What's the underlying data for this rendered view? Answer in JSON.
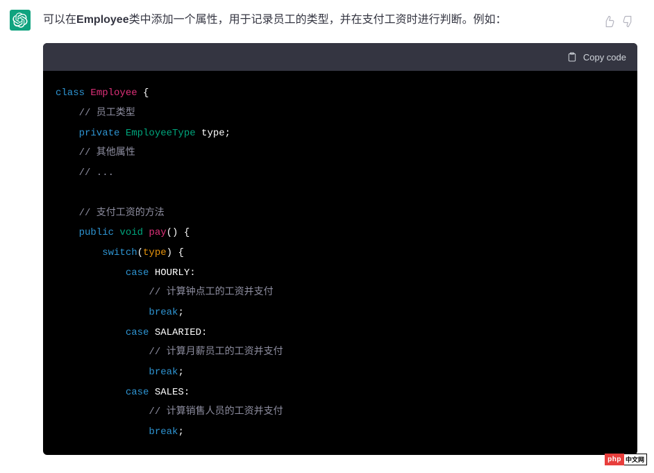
{
  "message": {
    "text_prefix": "可以在",
    "text_bold": "Employee",
    "text_suffix": "类中添加一个属性，用于记录员工的类型，并在支付工资时进行判断。例如：",
    "copy_label": "Copy code"
  },
  "code": {
    "l1_kw": "class",
    "l1_cls": "Employee",
    "l1_brace": " {",
    "l2": "    // 员工类型",
    "l3_kw": "    private",
    "l3_type": " EmployeeType",
    "l3_var": " type",
    "l3_semi": ";",
    "l4": "    // 其他属性",
    "l5": "    // ...",
    "blank": "",
    "l7": "    // 支付工资的方法",
    "l8_pub": "    public",
    "l8_void": " void",
    "l8_name": " pay",
    "l8_tail": "() {",
    "l9_sw": "        switch",
    "l9_open": "(",
    "l9_type": "type",
    "l9_close": ") {",
    "l10_case": "            case",
    "l10_val": " HOURLY",
    "l10_colon": ":",
    "l11": "                // 计算钟点工的工资并支付",
    "lbreak": "                break",
    "lsemi": ";",
    "l13_case": "            case",
    "l13_val": " SALARIED",
    "l13_colon": ":",
    "l14": "                // 计算月薪员工的工资并支付",
    "l16_case": "            case",
    "l16_val": " SALES",
    "l16_colon": ":",
    "l17": "                // 计算销售人员的工资并支付"
  },
  "watermark": {
    "left": "php",
    "right": "中文网"
  }
}
